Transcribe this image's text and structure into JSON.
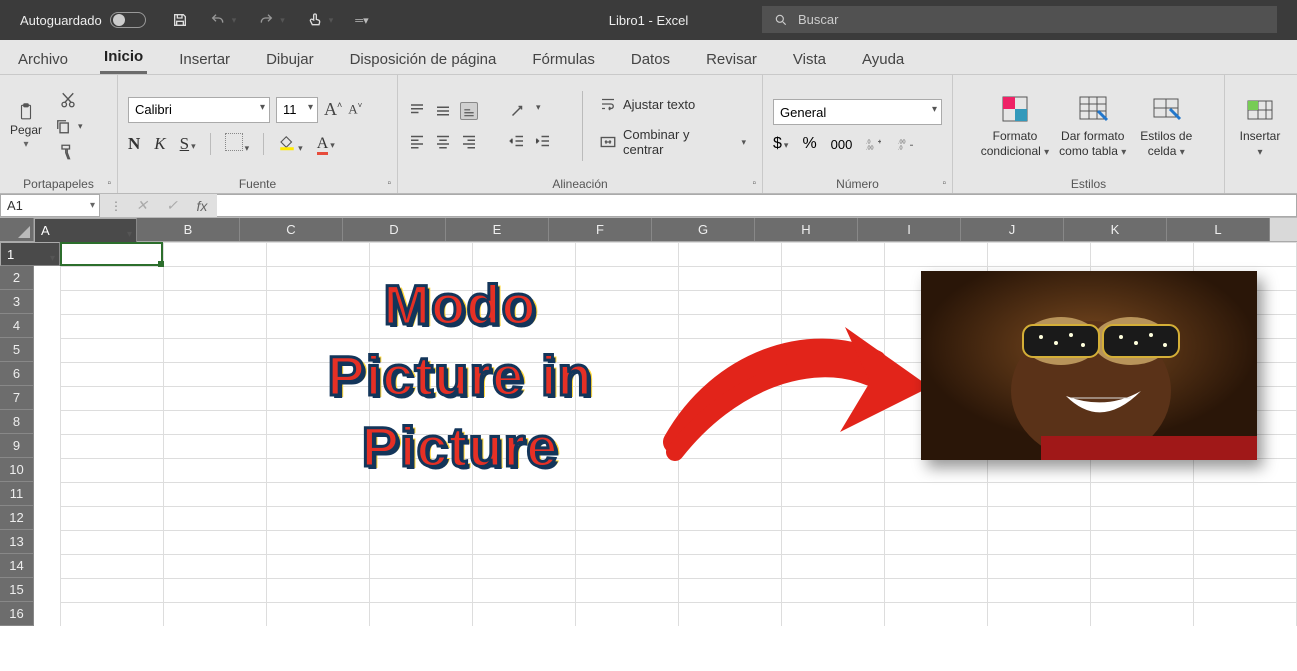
{
  "titlebar": {
    "autosave": "Autoguardado",
    "doc_title": "Libro1  -  Excel",
    "search_placeholder": "Buscar"
  },
  "tabs": {
    "archivo": "Archivo",
    "inicio": "Inicio",
    "insertar": "Insertar",
    "dibujar": "Dibujar",
    "disposicion": "Disposición de página",
    "formulas": "Fórmulas",
    "datos": "Datos",
    "revisar": "Revisar",
    "vista": "Vista",
    "ayuda": "Ayuda"
  },
  "ribbon": {
    "clipboard": {
      "paste": "Pegar",
      "label": "Portapapeles"
    },
    "font": {
      "name": "Calibri",
      "size": "11",
      "label": "Fuente",
      "bold": "N",
      "italic": "K",
      "underline": "S",
      "color_letter": "A"
    },
    "alignment": {
      "label": "Alineación",
      "wrap": "Ajustar texto",
      "merge": "Combinar y centrar"
    },
    "number": {
      "label": "Número",
      "format": "General",
      "currency": "$",
      "percent": "%",
      "thousands_a": "000",
      "inc": ".0",
      "dec": ".00"
    },
    "styles": {
      "label": "Estilos",
      "conditional_a": "Formato",
      "conditional_b": "condicional",
      "table_a": "Dar formato",
      "table_b": "como tabla",
      "cell_a": "Estilos de",
      "cell_b": "celda"
    },
    "cells": {
      "insert": "Insertar"
    }
  },
  "fbar": {
    "namebox": "A1",
    "fx": "fx",
    "x": "✕",
    "check": "✓"
  },
  "grid": {
    "cols": [
      "A",
      "B",
      "C",
      "D",
      "E",
      "F",
      "G",
      "H",
      "I",
      "J",
      "K",
      "L"
    ],
    "rows": [
      "1",
      "2",
      "3",
      "4",
      "5",
      "6",
      "7",
      "8",
      "9",
      "10",
      "11",
      "12",
      "13",
      "14",
      "15",
      "16"
    ]
  },
  "overlay": {
    "line1": "Modo",
    "line2": "Picture in",
    "line3": "Picture"
  }
}
